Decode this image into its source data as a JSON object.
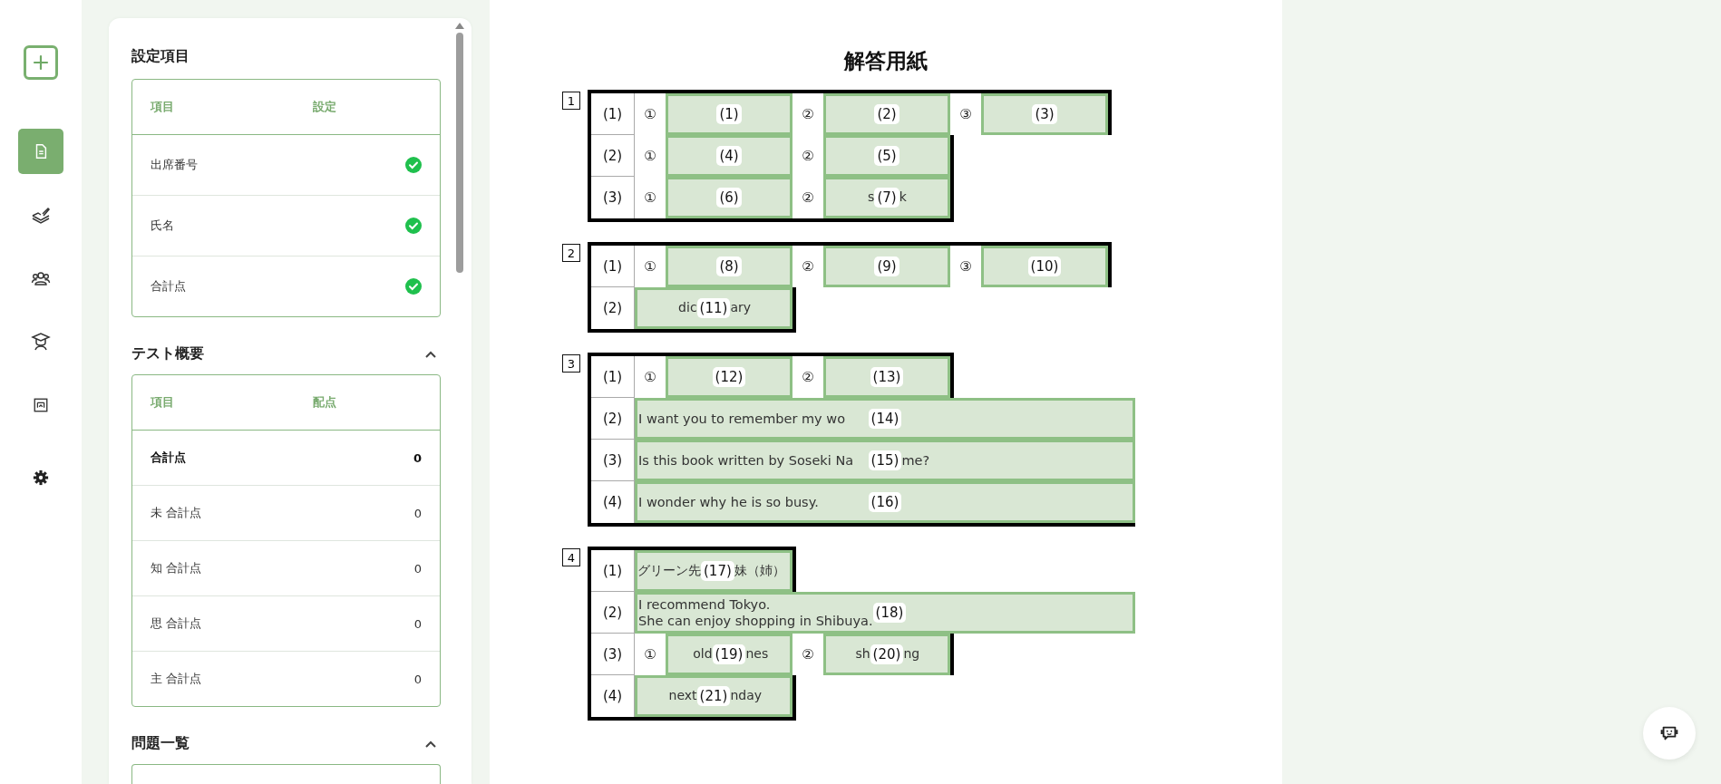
{
  "rail": {
    "items": [
      {
        "selected": true
      },
      {
        "selected": false
      },
      {
        "selected": false
      },
      {
        "selected": false
      },
      {
        "selected": false
      }
    ]
  },
  "settings": {
    "title": "設定項目",
    "columns": [
      "項目",
      "設定"
    ],
    "rows": [
      {
        "item": "出席番号",
        "checked": true
      },
      {
        "item": "氏名",
        "checked": true
      },
      {
        "item": "合計点",
        "checked": true
      }
    ]
  },
  "overview": {
    "title": "テスト概要",
    "expanded": true,
    "columns": [
      "項目",
      "配点"
    ],
    "rows": [
      {
        "item": "合計点",
        "points": "0",
        "kind": "total"
      },
      {
        "item": "未 合計点",
        "points": "0",
        "kind": "sub"
      },
      {
        "item": "知 合計点",
        "points": "0",
        "kind": "sub"
      },
      {
        "item": "思 合計点",
        "points": "0",
        "kind": "sub"
      },
      {
        "item": "主 合計点",
        "points": "0",
        "kind": "sub"
      }
    ]
  },
  "problems": {
    "title": "問題一覧",
    "expanded": true
  },
  "sheet": {
    "title": "解答用紙",
    "sections": [
      {
        "number": "1",
        "rows": [
          {
            "label": "(1)",
            "kind": "pairs",
            "parts": [
              {
                "circle": "①",
                "answer": {
                  "label": "(1)"
                }
              },
              {
                "circle": "②",
                "answer": {
                  "label": "(2)"
                }
              },
              {
                "circle": "③",
                "answer": {
                  "label": "(3)"
                }
              }
            ]
          },
          {
            "label": "(2)",
            "kind": "pairs",
            "parts": [
              {
                "circle": "①",
                "answer": {
                  "label": "(4)"
                }
              },
              {
                "circle": "②",
                "answer": {
                  "label": "(5)"
                }
              }
            ]
          },
          {
            "label": "(3)",
            "kind": "pairs",
            "parts": [
              {
                "circle": "①",
                "answer": {
                  "label": "(6)"
                }
              },
              {
                "circle": "②",
                "answer": {
                  "label": "(7)",
                  "before": [
                    "s"
                  ],
                  "after": "k"
                }
              }
            ]
          }
        ]
      },
      {
        "number": "2",
        "rows": [
          {
            "label": "(1)",
            "kind": "pairs",
            "parts": [
              {
                "circle": "①",
                "answer": {
                  "label": "(8)"
                }
              },
              {
                "circle": "②",
                "answer": {
                  "label": "(9)"
                }
              },
              {
                "circle": "③",
                "answer": {
                  "label": "(10)"
                }
              }
            ]
          },
          {
            "label": "(2)",
            "kind": "short",
            "answer": {
              "label": "(11)",
              "before": [
                "dic"
              ],
              "after": "ary"
            }
          }
        ]
      },
      {
        "number": "3",
        "rows": [
          {
            "label": "(1)",
            "kind": "pairs",
            "parts": [
              {
                "circle": "①",
                "answer": {
                  "label": "(12)"
                }
              },
              {
                "circle": "②",
                "answer": {
                  "label": "(13)"
                }
              }
            ]
          },
          {
            "label": "(2)",
            "kind": "long",
            "answer": {
              "label": "(14)",
              "before": [
                "I want you to remember my wo"
              ]
            }
          },
          {
            "label": "(3)",
            "kind": "long",
            "answer": {
              "label": "(15)",
              "before": [
                "Is this book written by Soseki Na"
              ],
              "after": "me?"
            }
          },
          {
            "label": "(4)",
            "kind": "long",
            "answer": {
              "label": "(16)",
              "before": [
                "I wonder why he is so busy."
              ]
            }
          }
        ]
      },
      {
        "number": "4",
        "rows": [
          {
            "label": "(1)",
            "kind": "short",
            "answer": {
              "label": "(17)",
              "before": [
                "グリーン先"
              ],
              "after": "妹（姉）"
            }
          },
          {
            "label": "(2)",
            "kind": "long",
            "answer": {
              "label": "(18)",
              "before": [
                "I recommend Tokyo.",
                "She can enjoy shopping in Shibuya."
              ]
            }
          },
          {
            "label": "(3)",
            "kind": "pairs",
            "parts": [
              {
                "circle": "①",
                "answer": {
                  "label": "(19)",
                  "before": [
                    "old"
                  ],
                  "after": "nes"
                }
              },
              {
                "circle": "②",
                "answer": {
                  "label": "(20)",
                  "before": [
                    "sh"
                  ],
                  "after": "ng"
                }
              }
            ]
          },
          {
            "label": "(4)",
            "kind": "short",
            "answer": {
              "label": "(21)",
              "before": [
                "next"
              ],
              "after": "nday"
            }
          }
        ]
      }
    ]
  }
}
